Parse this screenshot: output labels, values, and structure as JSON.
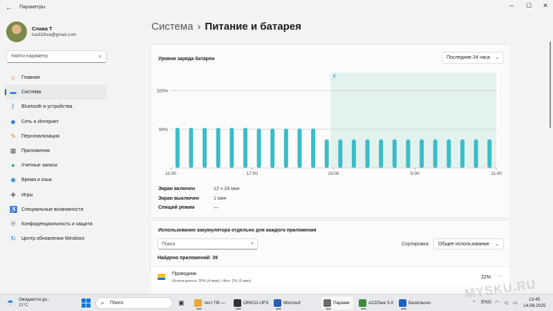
{
  "window": {
    "title": "Параметры",
    "back_icon": "back-arrow-icon"
  },
  "profile": {
    "name": "Слава Т",
    "email": "tva333tva@gmail.com"
  },
  "search": {
    "placeholder": "Найти параметр"
  },
  "nav": [
    {
      "label": "Главная",
      "icon": "home-icon",
      "color": "#d86a4a",
      "active": false
    },
    {
      "label": "Система",
      "icon": "system-icon",
      "color": "#1e7fd6",
      "active": true
    },
    {
      "label": "Bluetooth и устройства",
      "icon": "bluetooth-icon",
      "color": "#1e7fd6",
      "active": false
    },
    {
      "label": "Сеть и Интернет",
      "icon": "network-icon",
      "color": "#1e7fd6",
      "active": false
    },
    {
      "label": "Персонализация",
      "icon": "brush-icon",
      "color": "#e08a2a",
      "active": false
    },
    {
      "label": "Приложения",
      "icon": "apps-icon",
      "color": "#555555",
      "active": false
    },
    {
      "label": "Учетные записи",
      "icon": "account-icon",
      "color": "#2aa86a",
      "active": false
    },
    {
      "label": "Время и язык",
      "icon": "globe-icon",
      "color": "#1e7fd6",
      "active": false
    },
    {
      "label": "Игры",
      "icon": "gamepad-icon",
      "color": "#666666",
      "active": false
    },
    {
      "label": "Специальные возможности",
      "icon": "accessibility-icon",
      "color": "#1e7fd6",
      "active": false
    },
    {
      "label": "Конфиденциальность и защита",
      "icon": "shield-icon",
      "color": "#777777",
      "active": false
    },
    {
      "label": "Центр обновления Windows",
      "icon": "update-icon",
      "color": "#1e7fd6",
      "active": false
    }
  ],
  "breadcrumb": {
    "parent": "Система",
    "separator": "›",
    "current": "Питание и батарея"
  },
  "battery_card": {
    "title": "Уровни заряда батареи",
    "period": "Последние 24 часа",
    "stats": [
      {
        "label": "Экран включен",
        "value": "12 ч 24 мин"
      },
      {
        "label": "Экран выключен",
        "value": "1 мин"
      },
      {
        "label": "Спящий режим",
        "value": "—"
      }
    ]
  },
  "chart_data": {
    "type": "bar",
    "title": "Уровни заряда батареи",
    "ytick_labels": [
      "100%",
      "50%"
    ],
    "ylim": [
      0,
      100
    ],
    "xtick_labels": [
      "11:00",
      "17:00",
      "23:00",
      "5:00",
      "11:00"
    ],
    "values": [
      52,
      52,
      52,
      52,
      52,
      52,
      51,
      51,
      51,
      51,
      51,
      37,
      37,
      37,
      37,
      37,
      37,
      37,
      37,
      37,
      37,
      37,
      37,
      37
    ],
    "charging_start_index": 12,
    "bar_color": "#3cbcc8",
    "charging_region_color": "#e2f2ee",
    "charging_icon": "charging-bolt-icon"
  },
  "usage_card": {
    "title": "Использование аккумулятора отдельно для каждого приложения",
    "search_placeholder": "Поиск",
    "sort_label": "Сортировка:",
    "sort_value": "Общее использование",
    "found": "Найдено приложений: 39",
    "apps": [
      {
        "name": "Проводник",
        "detail": "Используется: 20% (4 мин) | Фон: 2% (5 мин)",
        "percent": "22%",
        "more": "···"
      }
    ]
  },
  "taskbar": {
    "weather_line1": "Ожидаются до...",
    "weather_line2": "21°C",
    "search": "Поиск",
    "apps": [
      {
        "label": "тест ПК —",
        "color": "#e8a93a"
      },
      {
        "label": "ORICO-UFS",
        "color": "#333333"
      },
      {
        "label": "Microsof",
        "color": "#2c5fb3"
      },
      {
        "label": "Парамe",
        "color": "#6b6b6b",
        "active": true
      },
      {
        "label": "ACDSee 5.0",
        "color": "#3c8a3c"
      },
      {
        "label": "Безопасно",
        "color": "#1e62c0"
      }
    ],
    "lang": "ENG",
    "time": "13:45",
    "date": "14.08.2025"
  }
}
